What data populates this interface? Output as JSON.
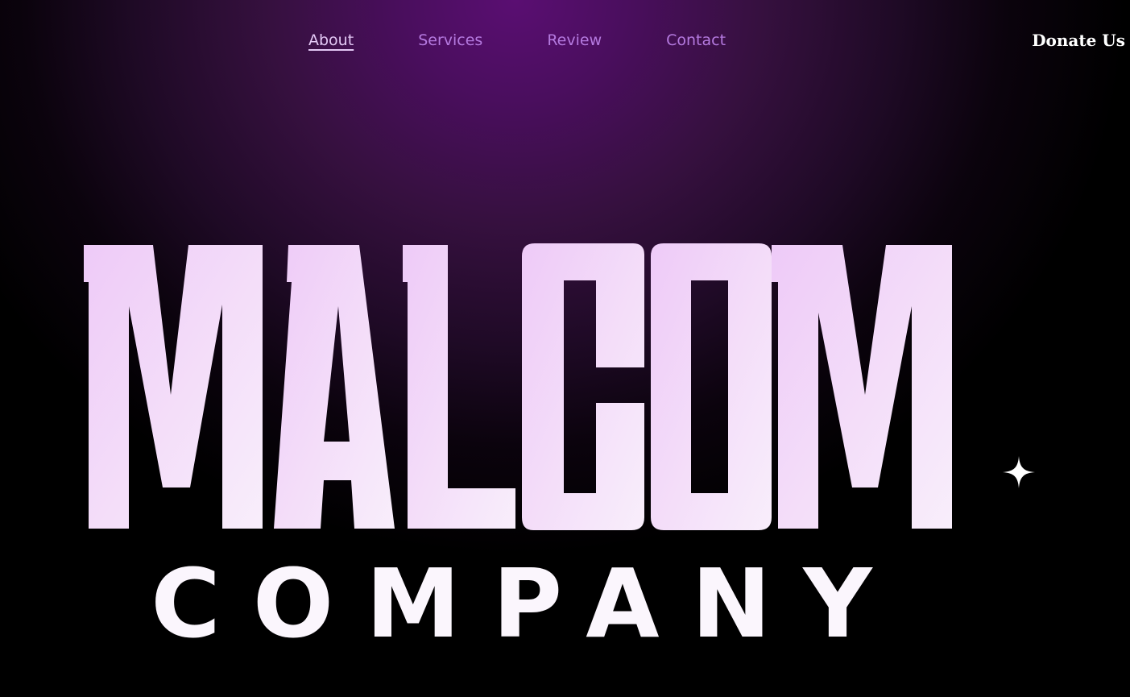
{
  "nav": {
    "items": [
      {
        "label": "About",
        "active": true
      },
      {
        "label": "Services",
        "active": false
      },
      {
        "label": "Review",
        "active": false
      },
      {
        "label": "Contact",
        "active": false
      }
    ]
  },
  "donate_label": "Donate Us",
  "logo": {
    "wordmark": "MALCOM",
    "subtitle": "COMPANY"
  },
  "colors": {
    "accent": "#b57ae0",
    "active_link": "#e3c8f5",
    "background_glow": "#5a0e72",
    "logo_fill": "#f3e2fb"
  },
  "icons": [
    "sparkle-icon"
  ]
}
